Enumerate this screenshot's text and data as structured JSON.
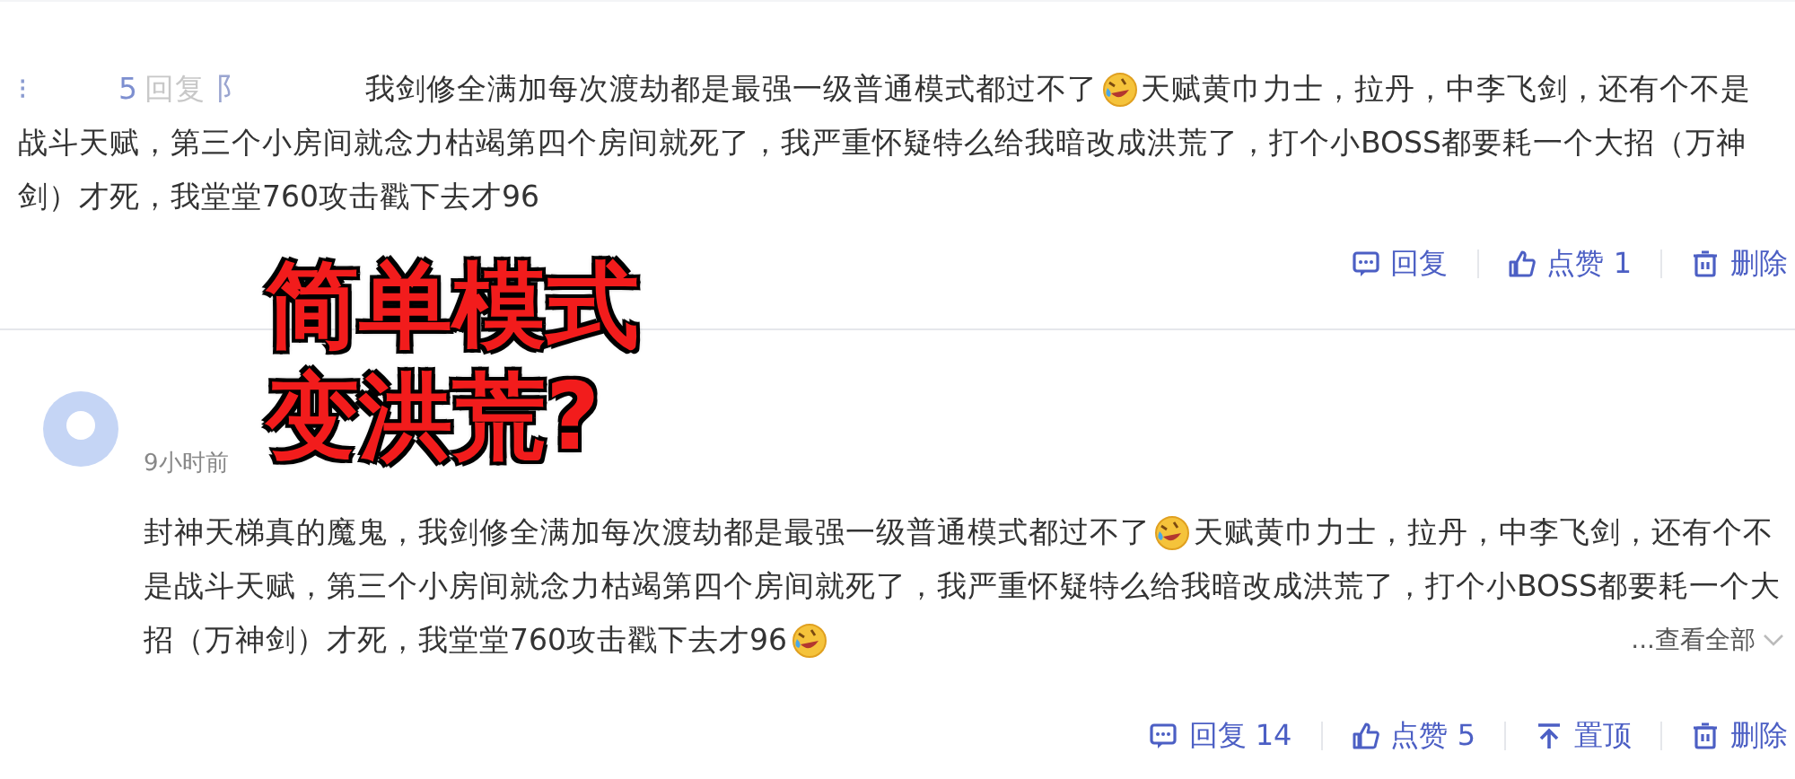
{
  "comments": [
    {
      "header": {
        "mark": "⁝",
        "count": "5",
        "reply_label": "回复",
        "fragment": "阝"
      },
      "lines": [
        [
          {
            "kind": "text",
            "text": "我剑修全满加每次渡劫都是最强一级普通模式都过不了"
          },
          {
            "kind": "emoji"
          },
          {
            "kind": "text",
            "text": "天赋黄巾力士，拉丹，中李飞剑，还有个不是"
          }
        ],
        [
          {
            "kind": "text",
            "text": "战斗天赋，第三个小房间就念力枯竭第四个房间就死了，我严重怀疑特么给我暗改成洪荒了，打个小BOSS都要耗一个大招（万神"
          }
        ],
        [
          {
            "kind": "text",
            "text": "剑）才死，我堂堂760攻击戳下去才96"
          }
        ]
      ],
      "actions": [
        {
          "kind": "reply",
          "label": "回复"
        },
        {
          "kind": "like",
          "label": "点赞 1"
        },
        {
          "kind": "delete",
          "label": "删除"
        }
      ]
    },
    {
      "time": "9小时前",
      "lines": [
        [
          {
            "kind": "text",
            "text": "封神天梯真的魔鬼，我剑修全满加每次渡劫都是最强一级普通模式都过不了"
          },
          {
            "kind": "emoji"
          },
          {
            "kind": "text",
            "text": "天赋黄巾力士，拉丹，中李飞剑，还有个不"
          }
        ],
        [
          {
            "kind": "text",
            "text": "是战斗天赋，第三个小房间就念力枯竭第四个房间就死了，我严重怀疑特么给我暗改成洪荒了，打个小BOSS都要耗一个大"
          }
        ],
        [
          {
            "kind": "text",
            "text": "招（万神剑）才死，我堂堂760攻击戳下去才96"
          },
          {
            "kind": "emoji"
          }
        ]
      ],
      "expand": "...查看全部",
      "actions": [
        {
          "kind": "reply",
          "label": "回复 14"
        },
        {
          "kind": "like",
          "label": "点赞 5"
        },
        {
          "kind": "pin",
          "label": "置顶"
        },
        {
          "kind": "delete",
          "label": "删除"
        }
      ]
    }
  ],
  "caption": [
    "简单模式",
    "变洪荒?"
  ]
}
